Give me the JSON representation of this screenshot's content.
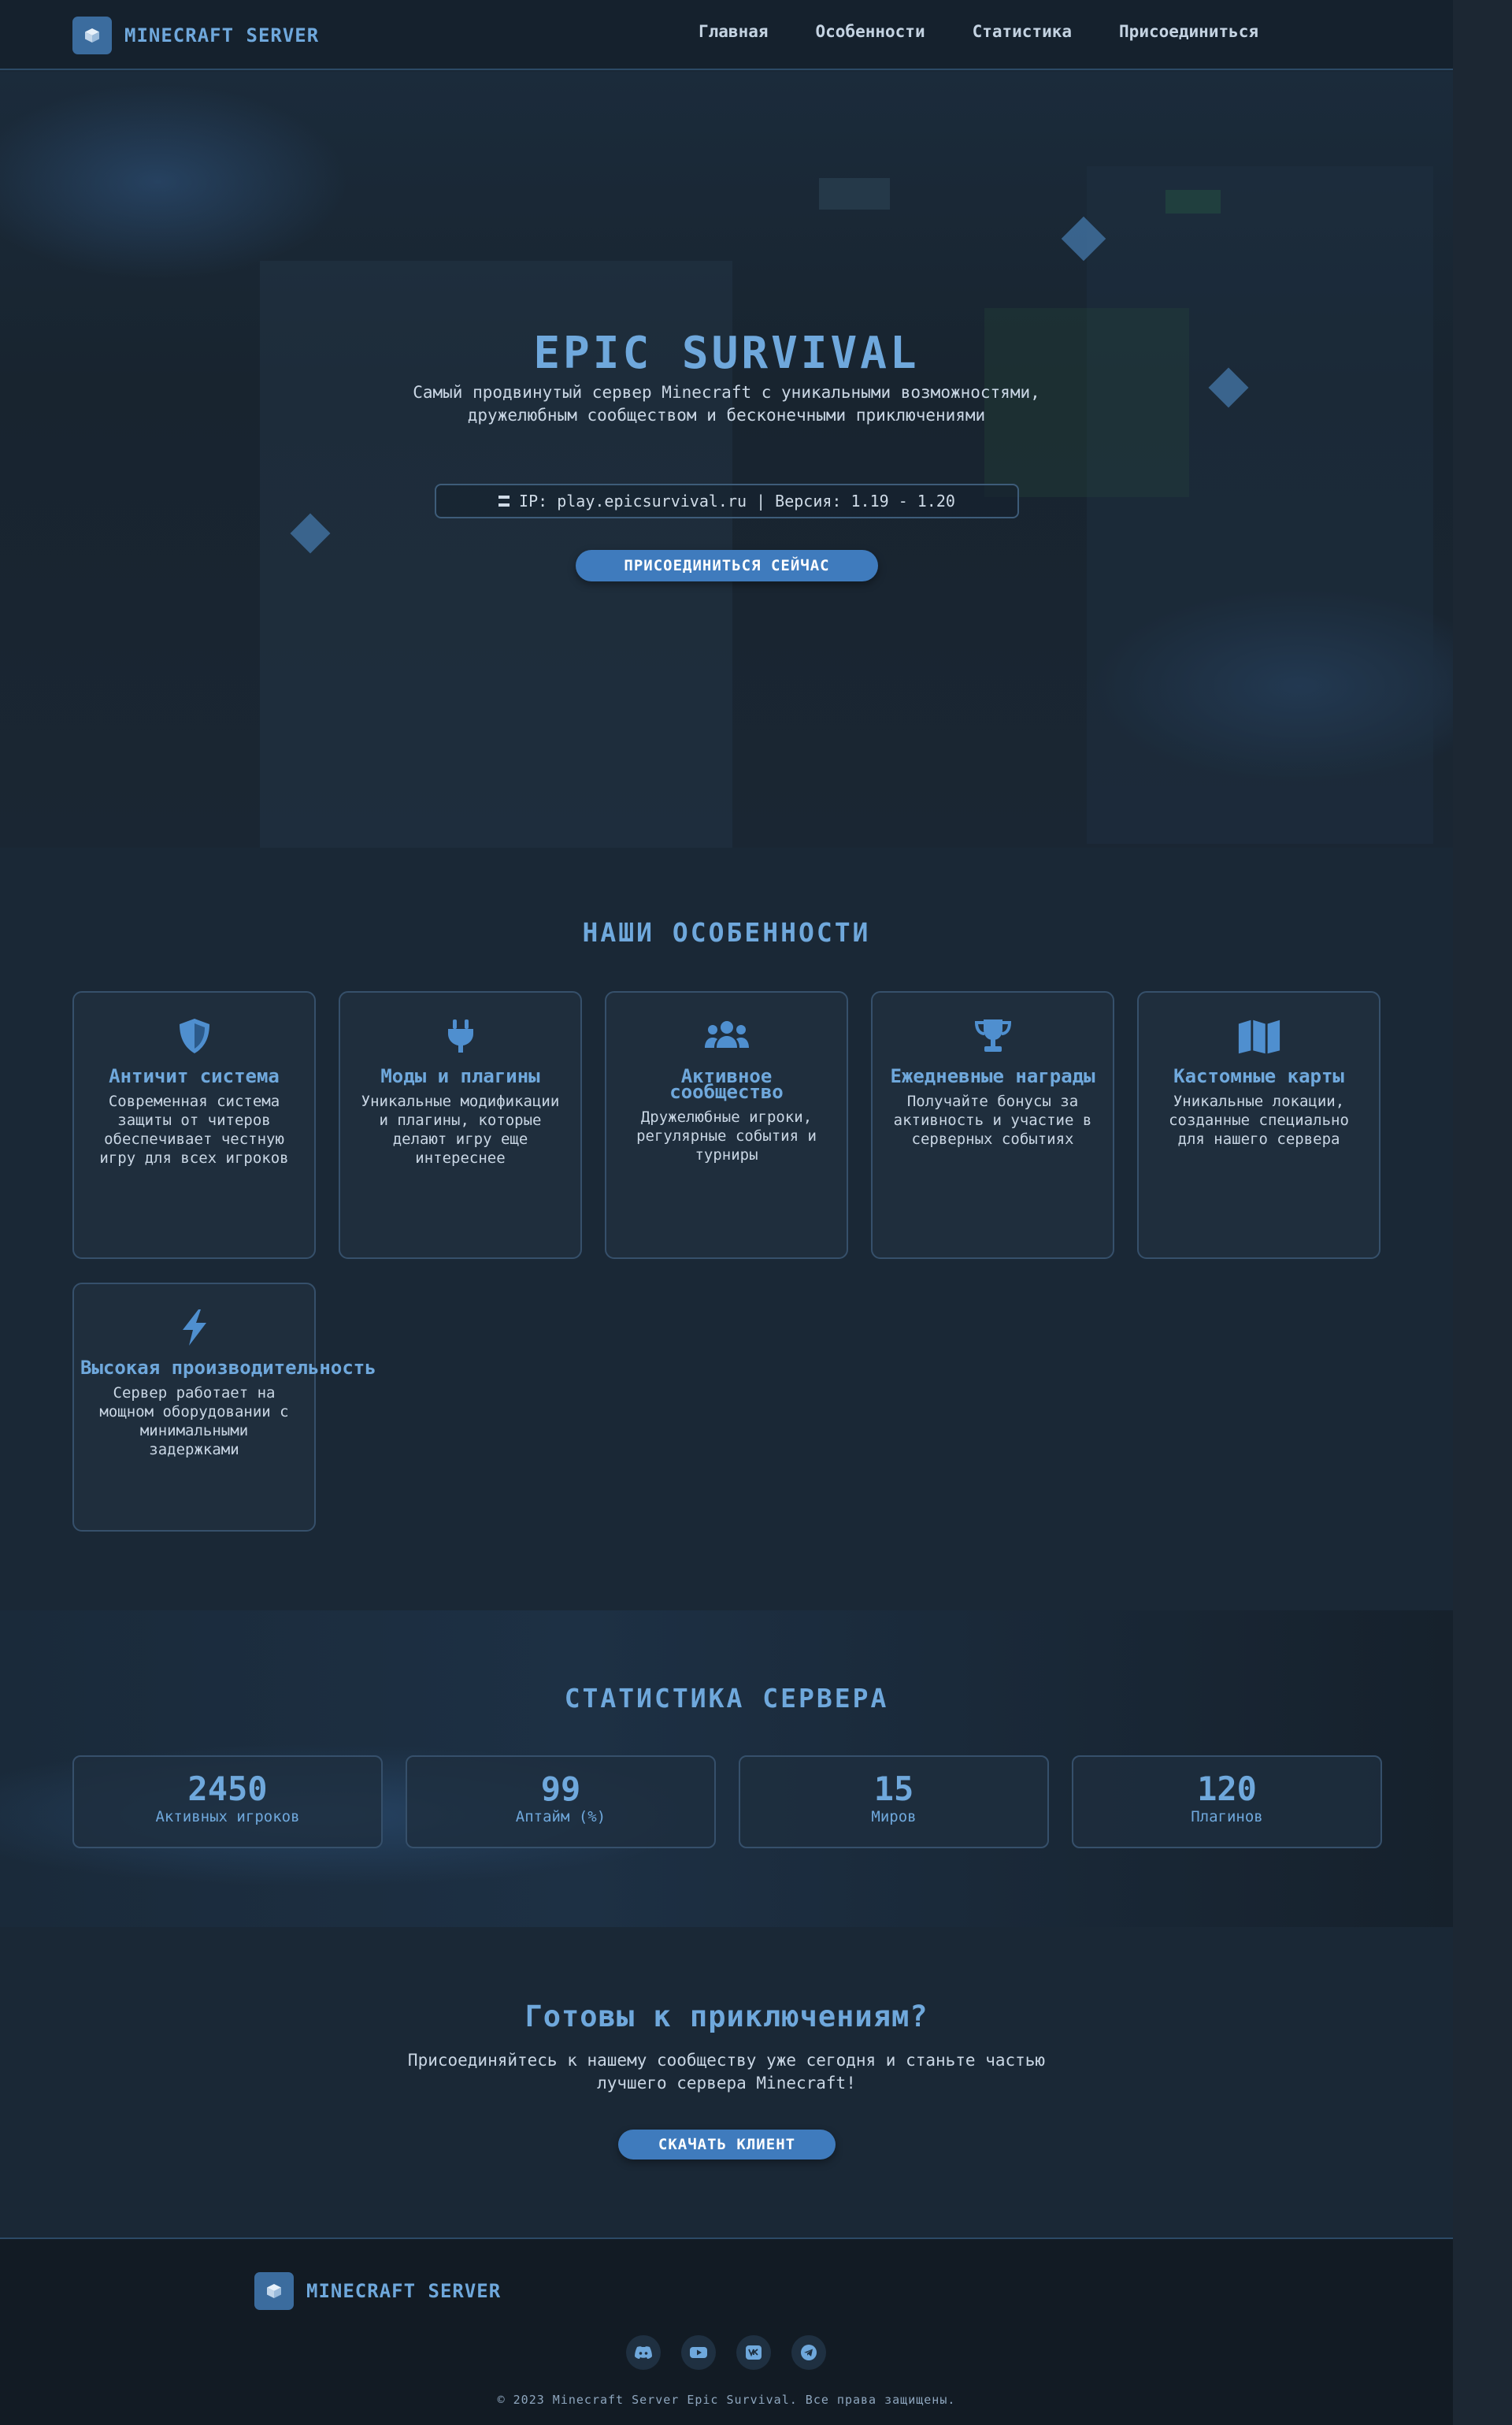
{
  "nav": {
    "logo_text": "MINECRAFT SERVER",
    "links": [
      "Главная",
      "Особенности",
      "Статистика",
      "Присоединиться"
    ]
  },
  "hero": {
    "title": "EPIC SURVIVAL",
    "description": "Самый продвинутый сервер Minecraft с уникальными возможностями, дружелюбным сообществом и бесконечными приключениями",
    "server_info": "IP: play.epicsurvival.ru | Версия: 1.19 - 1.20",
    "button": "ПРИСОЕДИНИТЬСЯ СЕЙЧАС"
  },
  "features": {
    "title": "НАШИ ОСОБЕННОСТИ",
    "items": [
      {
        "icon": "shield-icon",
        "title": "Античит система",
        "text": "Современная система защиты от читеров обеспечивает честную игру для всех игроков"
      },
      {
        "icon": "plug-icon",
        "title": "Моды и плагины",
        "text": "Уникальные модификации и плагины, которые делают игру еще интереснее"
      },
      {
        "icon": "users-icon",
        "title": "Активное сообщество",
        "text": "Дружелюбные игроки, регулярные события и турниры"
      },
      {
        "icon": "trophy-icon",
        "title": "Ежедневные награды",
        "text": "Получайте бонусы за активность и участие в серверных событиях"
      },
      {
        "icon": "map-icon",
        "title": "Кастомные карты",
        "text": "Уникальные локации, созданные специально для нашего сервера"
      },
      {
        "icon": "bolt-icon",
        "title": "Высокая производительность",
        "text": "Сервер работает на мощном оборудовании с минимальными задержками"
      }
    ]
  },
  "stats": {
    "title": "СТАТИСТИКА СЕРВЕРА",
    "items": [
      {
        "value": "2450",
        "label": "Активных игроков"
      },
      {
        "value": "99",
        "label": "Аптайм (%)"
      },
      {
        "value": "15",
        "label": "Миров"
      },
      {
        "value": "120",
        "label": "Плагинов"
      }
    ]
  },
  "cta": {
    "title": "Готовы к приключениям?",
    "text": "Присоединяйтесь к нашему сообществу уже сегодня и станьте частью лучшего сервера Minecraft!",
    "button": "СКАЧАТЬ КЛИЕНТ"
  },
  "footer": {
    "logo_text": "MINECRAFT SERVER",
    "socials": [
      "discord-icon",
      "youtube-icon",
      "vk-icon",
      "telegram-icon"
    ],
    "copyright": "© 2023 Minecraft Server Epic Survival. Все права защищены."
  },
  "colors": {
    "accent": "#6fa8dc",
    "button": "#3f7bbd",
    "background": "#1a2836"
  }
}
